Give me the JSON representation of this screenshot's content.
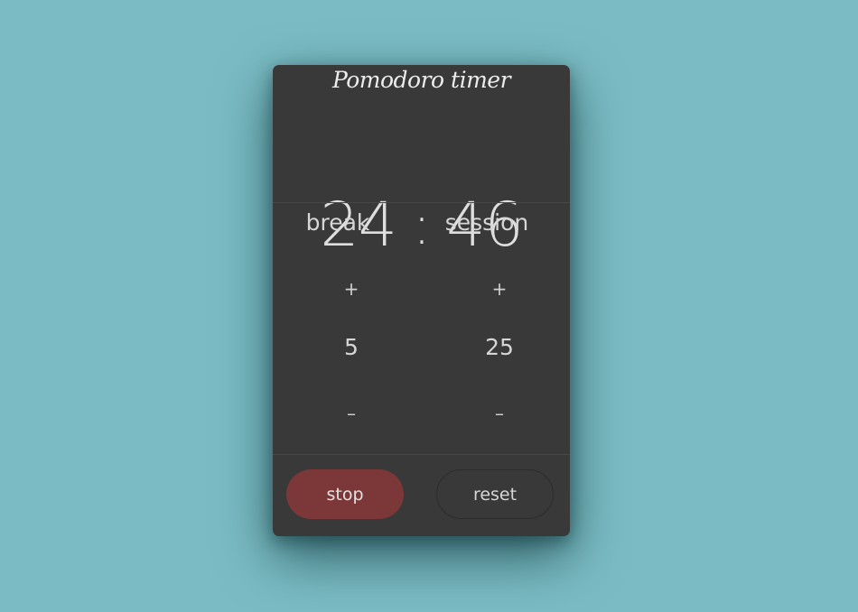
{
  "app": {
    "title": "Pomodoro timer"
  },
  "timer": {
    "minutes": "24",
    "separator": ":",
    "seconds": "46"
  },
  "break_control": {
    "label": "break",
    "increment": "+",
    "value": "5",
    "decrement": "–"
  },
  "session_control": {
    "label": "session",
    "increment": "+",
    "value": "25",
    "decrement": "–"
  },
  "actions": {
    "stop_label": "stop",
    "reset_label": "reset"
  },
  "colors": {
    "background": "#7bbcc4",
    "card": "#393939",
    "stop_button": "#7c3838",
    "text": "#d9d9d9"
  }
}
